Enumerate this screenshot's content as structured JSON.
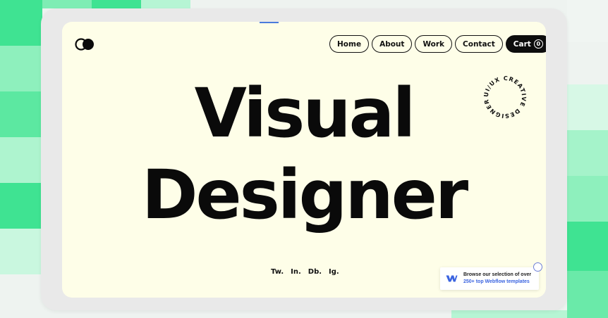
{
  "nav": {
    "items": [
      {
        "label": "Home"
      },
      {
        "label": "About"
      },
      {
        "label": "Work"
      },
      {
        "label": "Contact"
      }
    ],
    "cart_label": "Cart",
    "cart_count": "0"
  },
  "badge": {
    "circular_text": "UI/UX CREATIVE DESIGNER "
  },
  "hero": {
    "line1": "Visual",
    "line2": "Designer"
  },
  "socials": [
    "Tw.",
    "In.",
    "Db.",
    "Ig."
  ],
  "promo": {
    "line1": "Browse our selection of over",
    "line2": "250+ top Webflow templates",
    "icon": "webflow-icon"
  },
  "colors": {
    "screen_bg": "#fefee8",
    "text": "#0a0a0a",
    "accent_green": "#3ee08f",
    "promo_link": "#3b64e0"
  }
}
